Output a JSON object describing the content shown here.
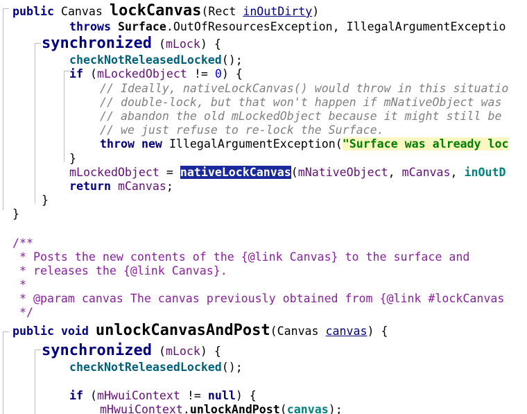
{
  "code": {
    "lockCanvas": {
      "sig_public": "public",
      "sig_type": "Canvas",
      "sig_name": "lockCanvas",
      "sig_param_type": "Rect",
      "sig_param_name": "inOutDirty",
      "throws_kw": "throws",
      "throws_class": "Surface",
      "throws_exc1": "OutOfResourcesException",
      "throws_exc2": "IllegalArgumentExceptio",
      "sync_kw": "synchronized",
      "sync_field": "mLock",
      "check_call": "checkNotReleasedLocked",
      "if_kw": "if",
      "if_field": "mLockedObject",
      "if_op": "!=",
      "if_num": "0",
      "comment_1": "// Ideally, nativeLockCanvas() would throw in this situatio",
      "comment_2": "// double-lock, but that won't happen if mNativeObject was",
      "comment_3": "// abandon the old mLockedObject because it might still be",
      "comment_4": "// we just refuse to re-lock the Surface.",
      "throw_kw": "throw",
      "new_kw": "new",
      "throw_class": "IllegalArgumentException",
      "throw_msg": "\"Surface was already loc",
      "assign_field": "mLockedObject",
      "native_call": "nativeLockCanvas",
      "native_arg1": "mNativeObject",
      "native_arg2": "mCanvas",
      "native_arg3": "inOutD",
      "return_kw": "return",
      "return_field": "mCanvas"
    },
    "javadoc": {
      "open": "/**",
      "line_1": " * Posts the new contents of the {@link Canvas} to the surface and",
      "line_2": " * releases the {@link Canvas}.",
      "line_3": " *",
      "line_4": " * @param canvas The canvas previously obtained from {@link #lockCanvas",
      "close": " */"
    },
    "unlockCanvasAndPost": {
      "sig_public": "public",
      "sig_void": "void",
      "sig_name": "unlockCanvasAndPost",
      "sig_param_type": "Canvas",
      "sig_param_name": "canvas",
      "sync_kw": "synchronized",
      "sync_field": "mLock",
      "check_call": "checkNotReleasedLocked",
      "if_kw": "if",
      "if_field": "mHwuiContext",
      "if_op": "!=",
      "if_null": "null",
      "call_obj": "mHwuiContext",
      "call_method": "unlockAndPost",
      "call_arg": "canvas"
    }
  },
  "colors": {
    "keyword": "#000080",
    "field": "#660e7a",
    "comment": "#808080",
    "javadoc": "#8a1fa0",
    "string": "#008000",
    "number": "#0000ff",
    "selection": "#1a2a9c"
  }
}
